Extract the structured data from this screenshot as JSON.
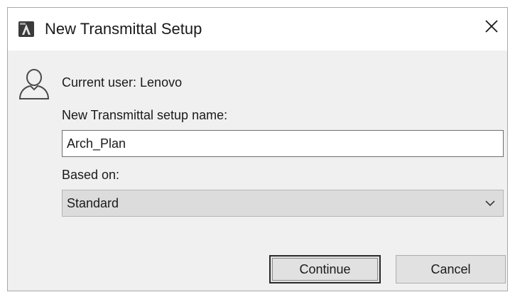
{
  "window": {
    "title": "New Transmittal Setup",
    "app_icon": "autocad-icon",
    "close_icon": "close-icon"
  },
  "user": {
    "icon": "user-icon",
    "text": "Current user: Lenovo"
  },
  "form": {
    "name_label": "New Transmittal setup name:",
    "name_value": "Arch_Plan",
    "based_on_label": "Based on:",
    "based_on_value": "Standard"
  },
  "buttons": {
    "continue_label": "Continue",
    "cancel_label": "Cancel"
  }
}
